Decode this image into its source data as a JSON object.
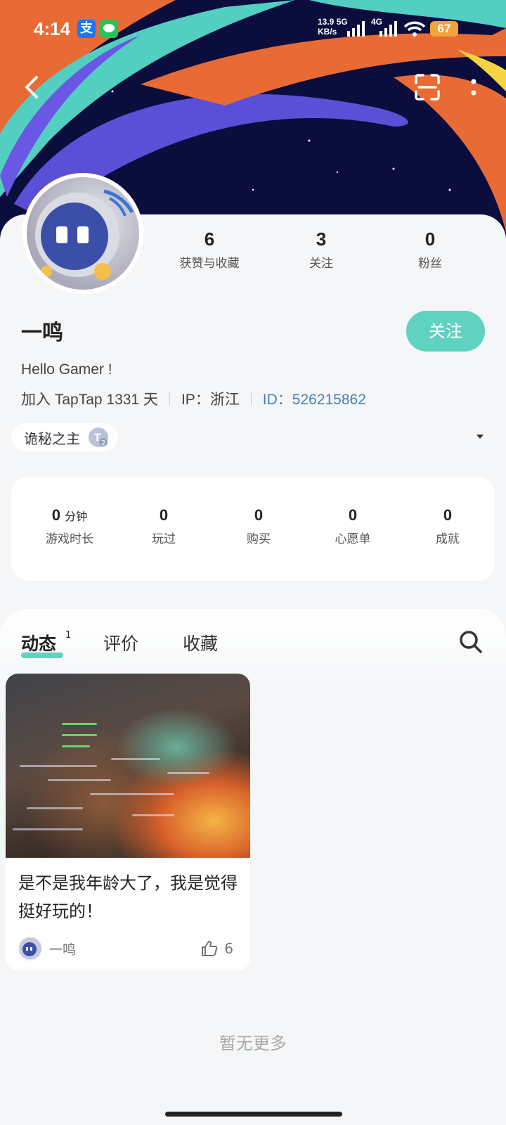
{
  "status_bar": {
    "time": "4:14",
    "app_icon_1": "支",
    "net_rate_value": "13.9",
    "net_rate_unit": "KB/s",
    "net_type_1": "5G",
    "net_type_2": "4G",
    "battery": "67"
  },
  "header": {
    "back_icon": "chevron-left-icon",
    "scan_icon": "scan-icon",
    "more_icon": "more-vertical-icon"
  },
  "profile": {
    "stats": [
      {
        "value": "6",
        "label": "获赞与收藏"
      },
      {
        "value": "3",
        "label": "关注"
      },
      {
        "value": "0",
        "label": "粉丝"
      }
    ],
    "name": "一鸣",
    "follow_label": "关注",
    "bio": "Hello Gamer !",
    "joined": "加入 TapTap 1331 天",
    "ip": "IP：浙江",
    "id": "ID：526215862",
    "tag": "诡秘之主"
  },
  "game_stats": [
    {
      "value": "0",
      "unit": "分钟",
      "label": "游戏时长"
    },
    {
      "value": "0",
      "unit": "",
      "label": "玩过"
    },
    {
      "value": "0",
      "unit": "",
      "label": "购买"
    },
    {
      "value": "0",
      "unit": "",
      "label": "心愿单"
    },
    {
      "value": "0",
      "unit": "",
      "label": "成就"
    }
  ],
  "tabs": [
    {
      "label": "动态",
      "badge": "1",
      "active": true
    },
    {
      "label": "评价",
      "active": false
    },
    {
      "label": "收藏",
      "active": false
    }
  ],
  "post": {
    "title": "是不是我年龄大了，我是觉得挺好玩的！",
    "author": "一鸣",
    "likes": "6"
  },
  "footer_text": "暂无更多",
  "colors": {
    "accent": "#5fd2c0",
    "id_link": "#4a7fb0",
    "banner_bg": "#0b0d3d"
  }
}
